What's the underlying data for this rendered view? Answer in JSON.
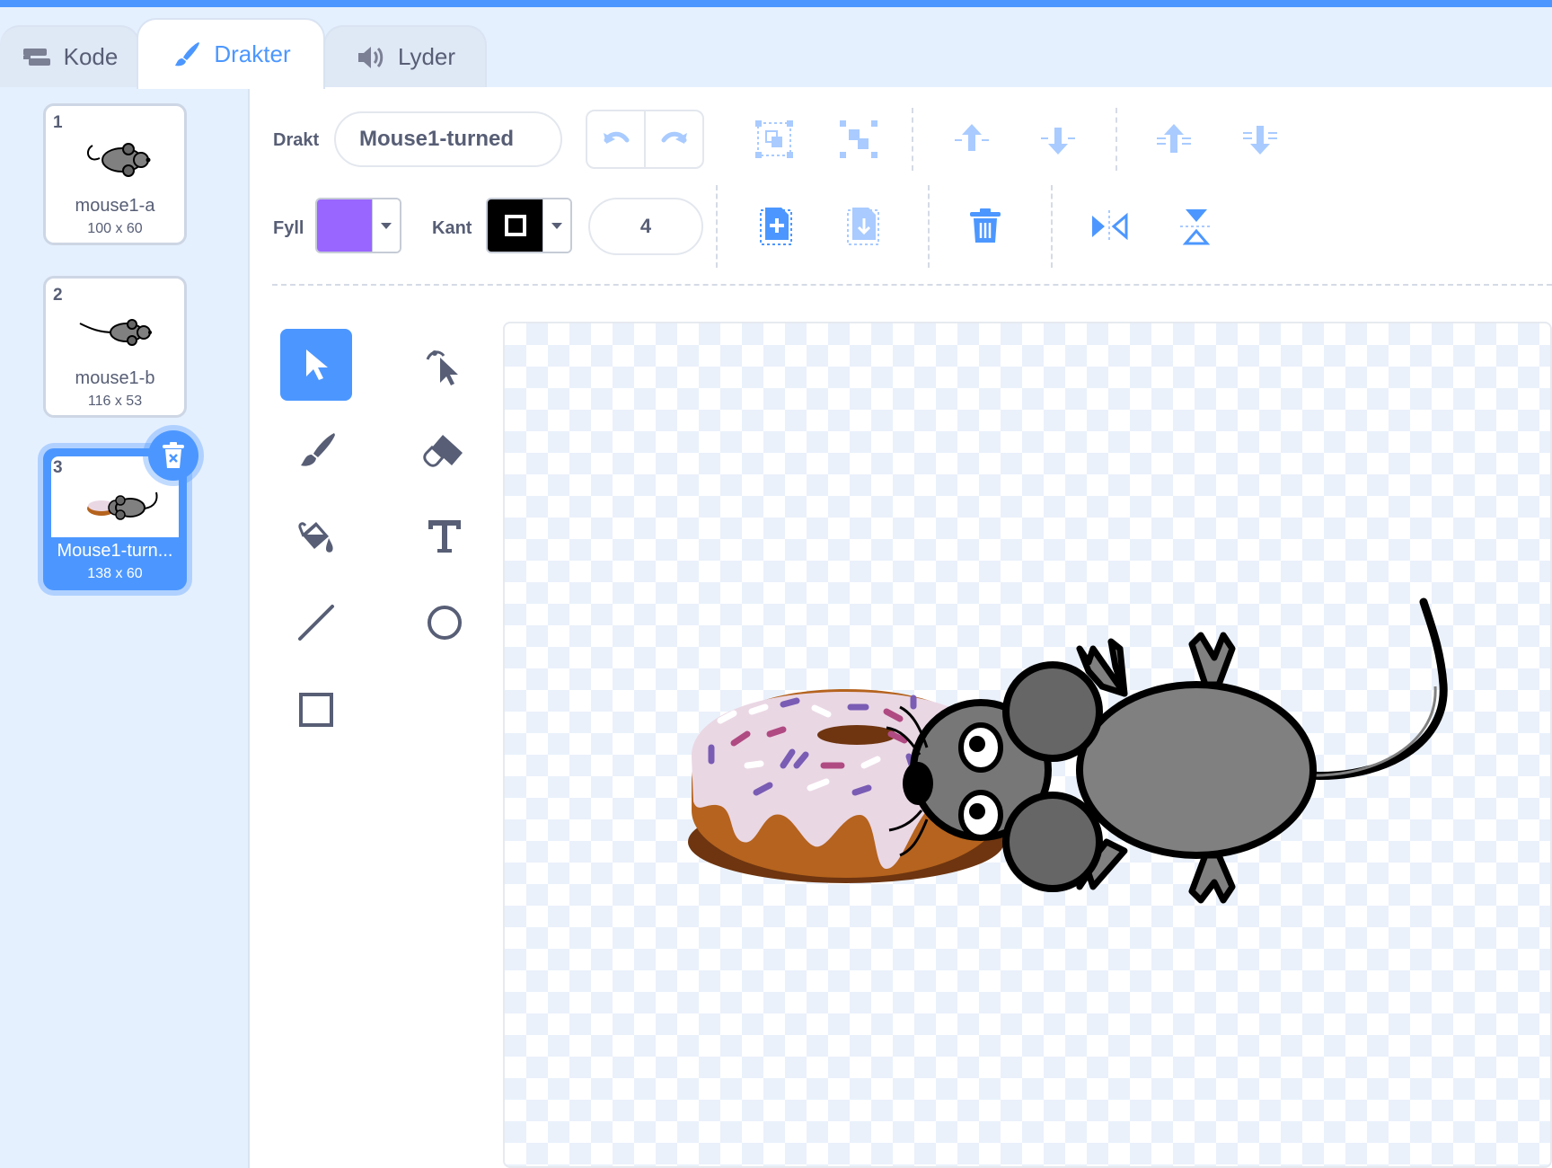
{
  "tabs": [
    {
      "label": "Kode",
      "icon": "code-blocks-icon",
      "active": false
    },
    {
      "label": "Drakter",
      "icon": "paintbrush-icon",
      "active": true
    },
    {
      "label": "Lyder",
      "icon": "speaker-icon",
      "active": false
    }
  ],
  "costumes": [
    {
      "number": "1",
      "name": "mouse1-a",
      "size": "100 x 60",
      "selected": false
    },
    {
      "number": "2",
      "name": "mouse1-b",
      "size": "116 x 53",
      "selected": false
    },
    {
      "number": "3",
      "name": "Mouse1-turn...",
      "size": "138 x 60",
      "selected": true
    }
  ],
  "toolbar": {
    "costume_label": "Drakt",
    "costume_name": "Mouse1-turned",
    "fill_label": "Fyll",
    "fill_color": "#9966ff",
    "outline_label": "Kant",
    "outline_color": "#000000",
    "outline_width": "4"
  },
  "colors": {
    "accent": "#4c97ff",
    "tab_background": "#e5f0ff",
    "text": "#575e75",
    "icon_light": "#a9cbff"
  }
}
